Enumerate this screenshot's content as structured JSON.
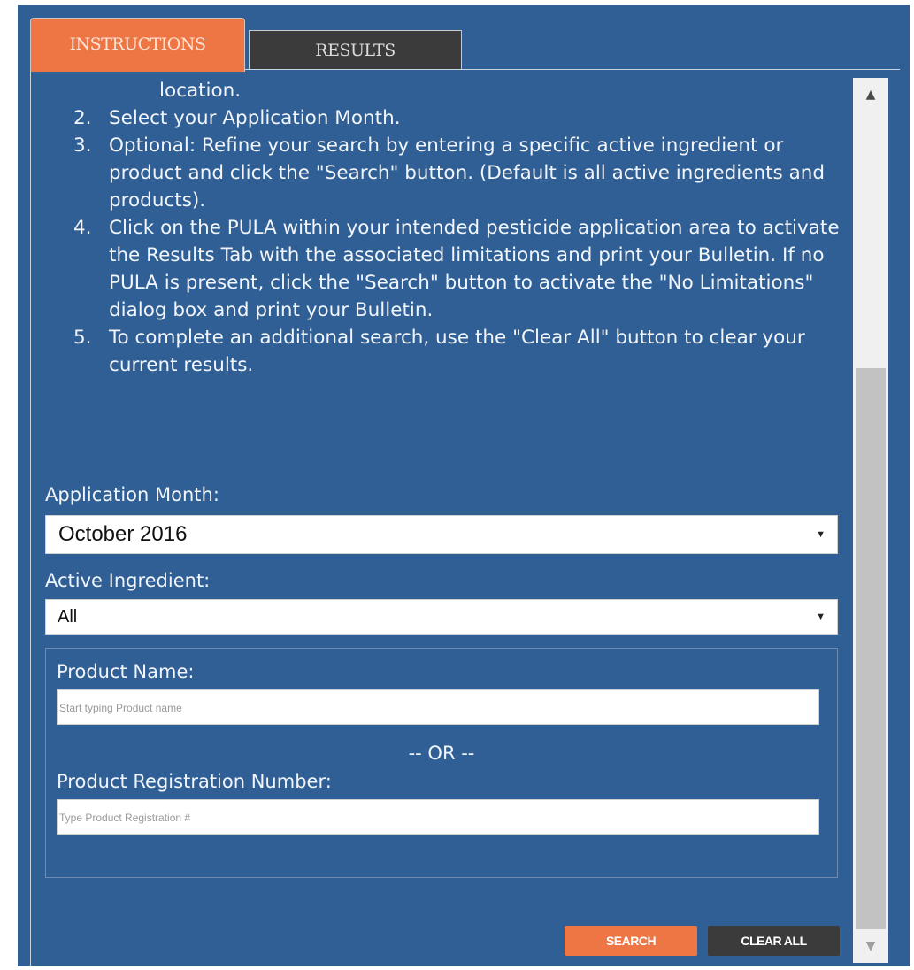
{
  "tabs": {
    "instructions": "INSTRUCTIONS",
    "results": "RESULTS"
  },
  "instructions": {
    "continued_line": "location.",
    "steps": [
      {
        "num": "2.",
        "text": "Select your Application Month."
      },
      {
        "num": "3.",
        "text": "Optional: Refine your search by entering a specific active ingredient or product and click the \"Search\" button. (Default is all active ingredients and products)."
      },
      {
        "num": "4.",
        "text": "Click on the PULA within your intended pesticide application area to activate the Results Tab with the associated limitations and print your Bulletin. If no PULA is present, click the \"Search\" button to activate the \"No Limitations\" dialog box and print your Bulletin."
      },
      {
        "num": "5.",
        "text": "To complete an additional search, use the \"Clear All\" button to clear your current results."
      }
    ]
  },
  "form": {
    "month_label": "Application Month:",
    "month_value": "October 2016",
    "ingredient_label": "Active Ingredient:",
    "ingredient_value": "All",
    "product_name_label": "Product Name:",
    "product_name_placeholder": "Start typing Product name",
    "or_separator": "-- OR --",
    "registration_label": "Product Registration Number:",
    "registration_placeholder": "Type Product Registration #"
  },
  "buttons": {
    "search": "SEARCH",
    "clear_all": "CLEAR ALL"
  },
  "icons": {
    "dropdown": "caret-down-icon",
    "scroll_up": "triangle-up-icon",
    "scroll_down": "triangle-down-icon"
  },
  "colors": {
    "panel_bg": "#2f5f95",
    "accent_orange": "#ee7644",
    "dark_button": "#3b3b3b"
  }
}
